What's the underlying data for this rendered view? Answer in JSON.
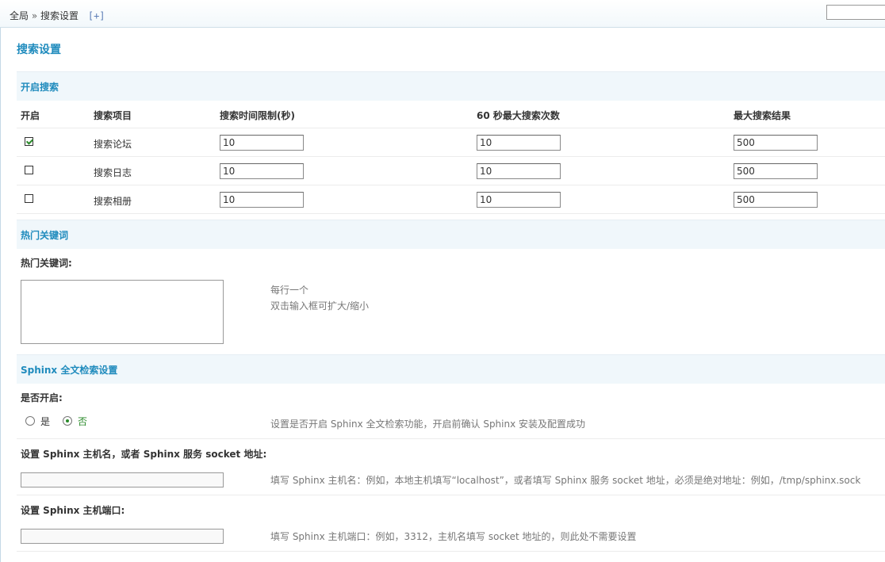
{
  "breadcrumb": {
    "root": "全局",
    "sep": "»",
    "current": "搜索设置",
    "plus": "[+]"
  },
  "page_title": "搜索设置",
  "sections": {
    "open_search": "开启搜索",
    "hot_keywords": "热门关键词",
    "sphinx": "Sphinx 全文检索设置"
  },
  "search_table": {
    "headers": [
      "开启",
      "搜索项目",
      "搜索时间限制(秒)",
      "60 秒最大搜索次数",
      "最大搜索结果"
    ],
    "rows": [
      {
        "enabled": true,
        "name": "搜索论坛",
        "time_limit": "10",
        "max_per_60s": "10",
        "max_results": "500"
      },
      {
        "enabled": false,
        "name": "搜索日志",
        "time_limit": "10",
        "max_per_60s": "10",
        "max_results": "500"
      },
      {
        "enabled": false,
        "name": "搜索相册",
        "time_limit": "10",
        "max_per_60s": "10",
        "max_results": "500"
      }
    ]
  },
  "hot_keywords": {
    "label": "热门关键词:",
    "hint_line1": "每行一个",
    "hint_line2": "双击输入框可扩大/缩小",
    "value": ""
  },
  "sphinx": {
    "enable_label": "是否开启:",
    "yes": "是",
    "no": "否",
    "selected": "no",
    "enable_hint": "设置是否开启 Sphinx 全文检索功能，开启前确认 Sphinx 安装及配置成功",
    "host_label": "设置 Sphinx 主机名，或者 Sphinx 服务 socket 地址:",
    "host_hint": "填写 Sphinx 主机名：例如，本地主机填写“localhost”，或者填写 Sphinx 服务 socket 地址，必须是绝对地址：例如，/tmp/sphinx.sock",
    "host_value": "",
    "port_label": "设置 Sphinx 主机端口:",
    "port_hint": "填写 Sphinx 主机端口：例如，3312，主机名填写 socket 地址的，则此处不需要设置",
    "port_value": ""
  }
}
